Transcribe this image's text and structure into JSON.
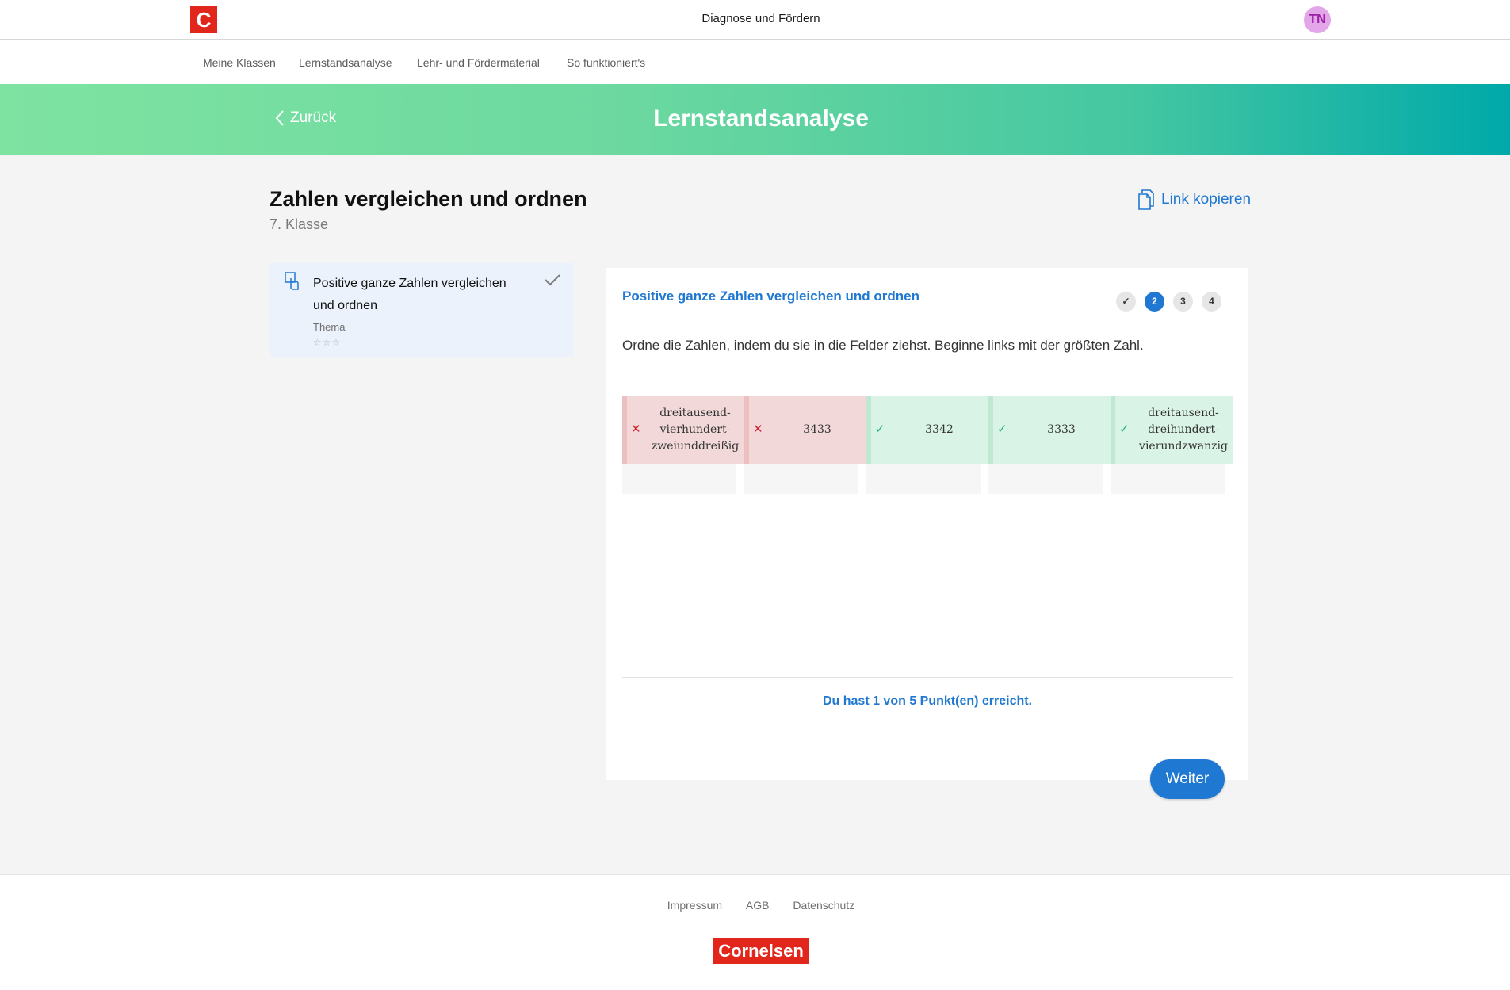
{
  "header": {
    "logo_letter": "C",
    "app_title": "Diagnose und Fördern",
    "avatar_initials": "TN"
  },
  "nav": {
    "items": [
      "Meine Klassen",
      "Lernstandsanalyse",
      "Lehr- und Fördermaterial",
      "So funktioniert's"
    ]
  },
  "banner": {
    "back_label": "Zurück",
    "title": "Lernstandsanalyse"
  },
  "page": {
    "title": "Zahlen vergleichen und ordnen",
    "subtitle": "7. Klasse",
    "copy_link_label": "Link kopieren"
  },
  "sidebar": {
    "topic": {
      "title": "Positive ganze Zahlen vergleichen und ordnen",
      "label": "Thema",
      "stars": "☆☆☆",
      "completed": true
    }
  },
  "exercise": {
    "title": "Positive ganze Zahlen vergleichen und ordnen",
    "steps": [
      "✓",
      "2",
      "3",
      "4"
    ],
    "active_step": 2,
    "instruction": "Ordne die Zahlen, indem du sie in die Felder ziehst. Beginne links mit der größten Zahl.",
    "answers": [
      {
        "text": "dreitausend-\nvierhundert-\nzweiunddreißig",
        "correct": false
      },
      {
        "text": "3433",
        "correct": false
      },
      {
        "text": "3342",
        "correct": true
      },
      {
        "text": "3333",
        "correct": true
      },
      {
        "text": "dreitausend-\ndreihundert-\nvierundzwanzig",
        "correct": true
      }
    ],
    "score_text": "Du hast 1 von 5 Punkt(en) erreicht.",
    "next_label": "Weiter"
  },
  "footer": {
    "links": [
      "Impressum",
      "AGB",
      "Datenschutz"
    ],
    "brand": "Cornelsen"
  },
  "colors": {
    "accent": "#1f78d1",
    "brand_red": "#e1261c",
    "wrong": "#d0212f",
    "correct": "#1cb371"
  },
  "icons": {
    "back": "chevron-left-icon",
    "copy": "copy-document-icon",
    "topic": "touch-drag-icon",
    "check": "check-icon",
    "wrong": "cross-icon"
  }
}
